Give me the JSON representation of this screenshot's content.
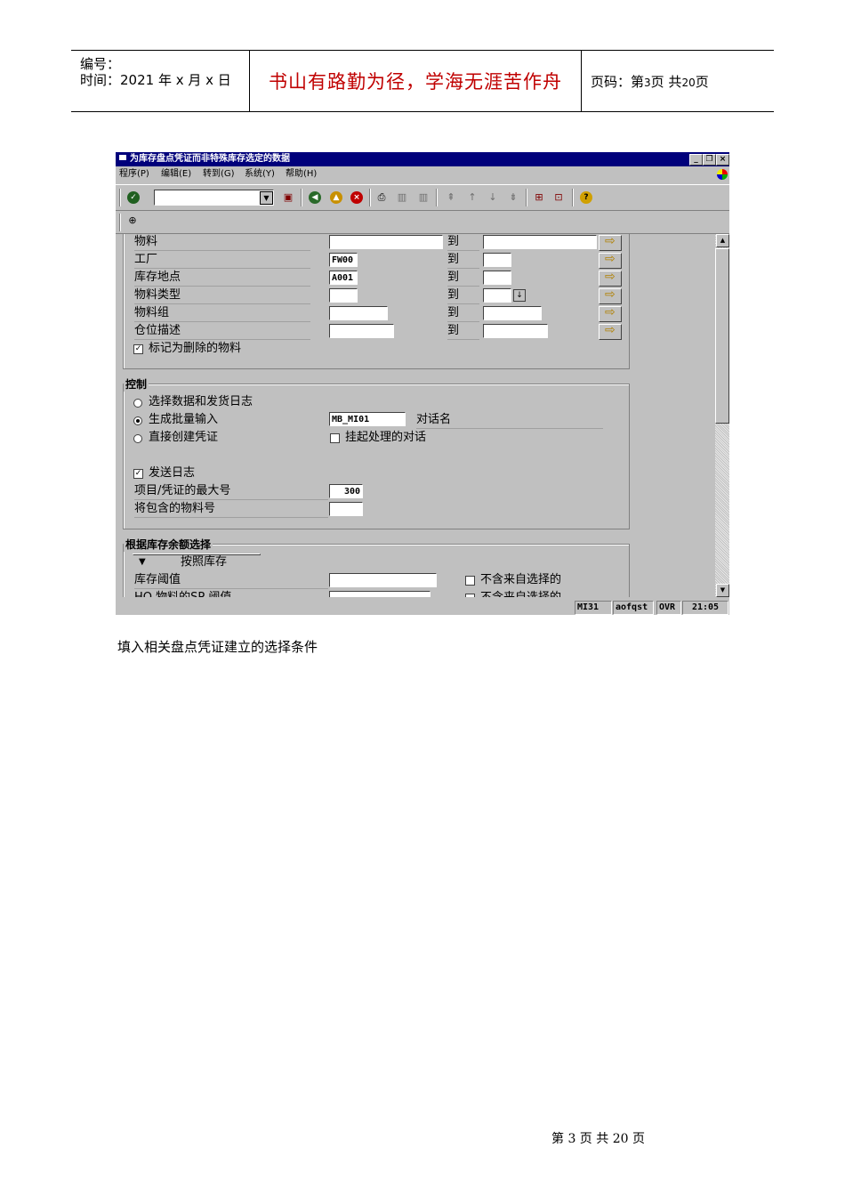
{
  "header": {
    "number_label": "编号：",
    "time_label": "时间：2021 年 x 月 x 日",
    "motto": "书山有路勤为径，学海无涯苦作舟",
    "page_label_prefix": "页码：第",
    "page_current": "3",
    "page_mid": "页  共",
    "page_total": "20",
    "page_suffix": "页"
  },
  "window": {
    "title": "为库存盘点凭证而非特殊库存选定的数据",
    "menu": [
      "程序(P)",
      "编辑(E)",
      "转到(G)",
      "系统(Y)",
      "帮助(H)"
    ]
  },
  "selection": {
    "rows": [
      {
        "label": "物料",
        "from": "",
        "to_label": "到",
        "to": ""
      },
      {
        "label": "工厂",
        "from": "FW00",
        "to_label": "到",
        "to": ""
      },
      {
        "label": "库存地点",
        "from": "A001",
        "to_label": "到",
        "to": ""
      },
      {
        "label": "物料类型",
        "from": "",
        "to_label": "到",
        "to": ""
      },
      {
        "label": "物料组",
        "from": "",
        "to_label": "到",
        "to": ""
      },
      {
        "label": "仓位描述",
        "from": "",
        "to_label": "到",
        "to": ""
      }
    ],
    "deleted_flag_label": "标记为删除的物料"
  },
  "control": {
    "title": "控制",
    "radio1": "选择数据和发货日志",
    "radio2": "生成批量输入",
    "radio3": "直接创建凭证",
    "session_value": "MB_MI01",
    "session_label": "对话名",
    "hold_label": "挂起处理的对话",
    "log_label": "发送日志",
    "max_items_label": "项目/凭证的最大号",
    "max_items_value": "300",
    "include_label": "将包含的物料号",
    "include_value": ""
  },
  "stock_balance": {
    "title": "根据库存余额选择",
    "button": "按照库存",
    "threshold_label": "库存阈值",
    "exclude_label": "不含来自选择的",
    "row2_label": "HQ 物料的SP 阈值",
    "exclude_label2": "不含来自选择的"
  },
  "status": {
    "tcode": "MI31",
    "server": "aofqst",
    "mode": "OVR",
    "time": "21:05"
  },
  "caption": "填入相关盘点凭证建立的选择条件",
  "footer": "第 3 页 共 20 页"
}
